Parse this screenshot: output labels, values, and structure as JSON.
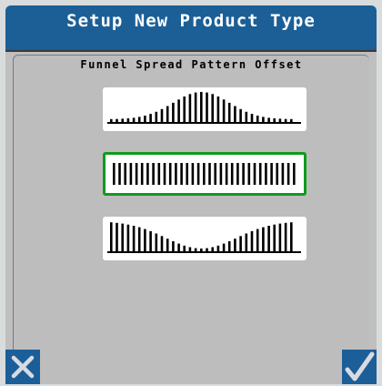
{
  "header": {
    "title": "Setup New Product Type"
  },
  "content": {
    "subtitle": "Funnel Spread Pattern Offset"
  },
  "patterns": [
    {
      "name": "center-heavy",
      "selected": false
    },
    {
      "name": "uniform",
      "selected": true
    },
    {
      "name": "edge-heavy",
      "selected": false
    }
  ],
  "footer": {
    "cancel_icon": "close-x-icon",
    "confirm_icon": "checkmark-icon"
  },
  "colors": {
    "title_bar": "#1b5f96",
    "panel": "#bfbfbf",
    "selected_border": "#119a1c",
    "button": "#1c5e98"
  }
}
